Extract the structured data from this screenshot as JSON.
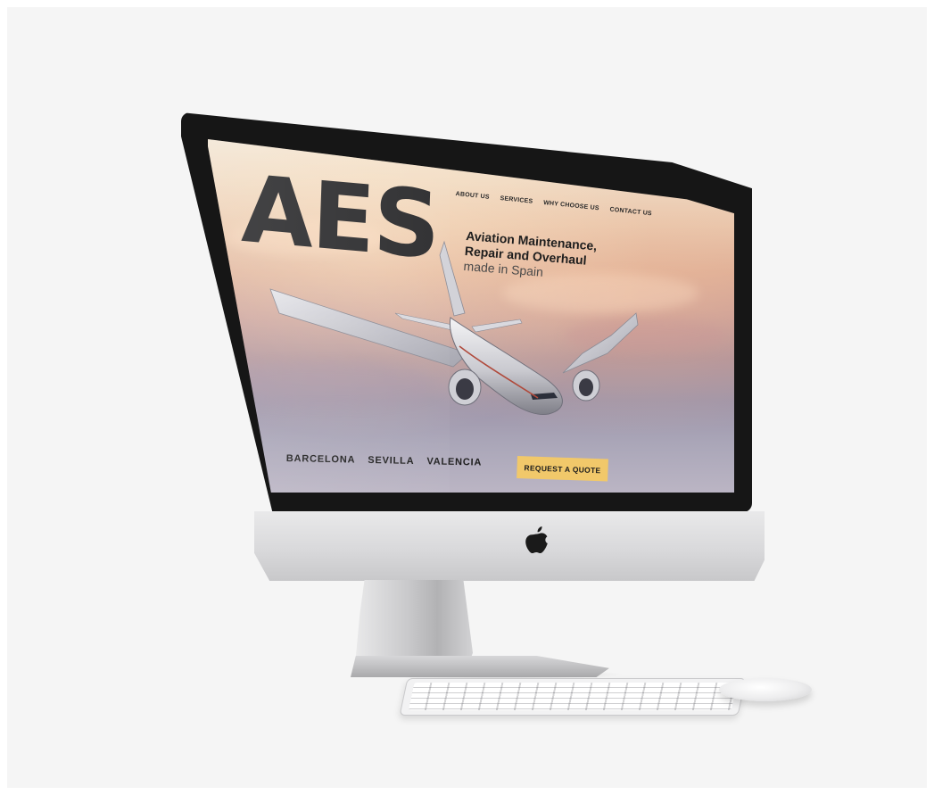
{
  "site": {
    "brand": "AES",
    "nav": [
      "ABOUT US",
      "SERVICES",
      "WHY CHOOSE US",
      "CONTACT US"
    ],
    "headline": {
      "line1": "Aviation Maintenance,",
      "line2": "Repair and Overhaul",
      "line3": "made in Spain"
    },
    "cities": [
      "BARCELONA",
      "SEVILLA",
      "VALENCIA"
    ],
    "cta": "REQUEST A QUOTE"
  },
  "colors": {
    "cta_background": "#f1c86a",
    "brand_text": "#2c2c2e",
    "bezel": "#161616",
    "aluminum": "#d9d9db"
  },
  "icons": {
    "hardware_logo": "apple-logo-icon"
  }
}
